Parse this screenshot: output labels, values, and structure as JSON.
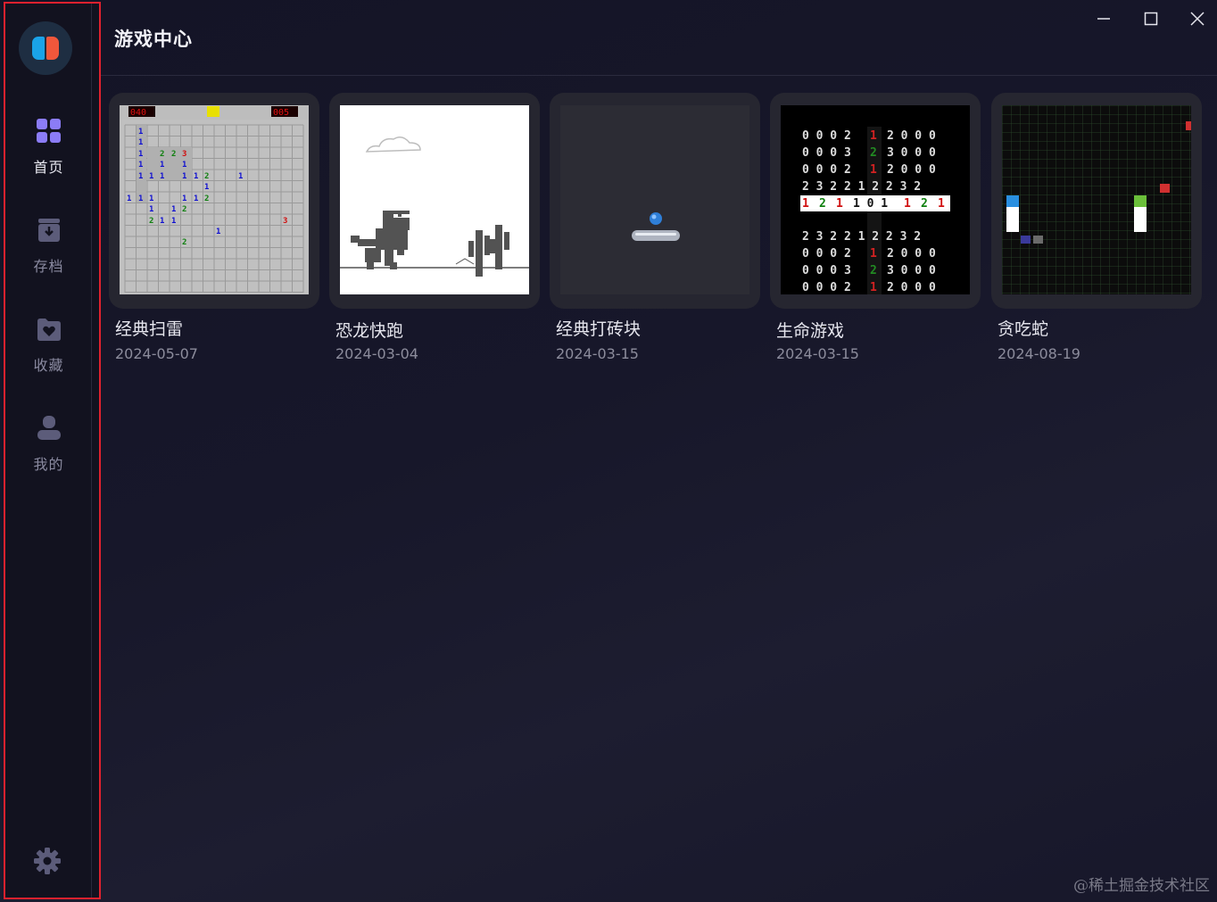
{
  "app": {
    "title": "游戏中心",
    "accent_color": "#8b7cf6",
    "highlight_border_color": "#e0212e"
  },
  "sidebar": {
    "logo_icon": "game-controller-logo",
    "items": [
      {
        "label": "首页",
        "icon": "grid-icon",
        "active": true
      },
      {
        "label": "存档",
        "icon": "archive-box-icon",
        "active": false
      },
      {
        "label": "收藏",
        "icon": "folder-heart-icon",
        "active": false
      },
      {
        "label": "我的",
        "icon": "user-icon",
        "active": false
      }
    ],
    "settings_icon": "gear-icon"
  },
  "window_controls": [
    "minimize-icon",
    "maximize-icon",
    "close-icon"
  ],
  "games": [
    {
      "title": "经典扫雷",
      "date": "2024-05-07",
      "thumbnail": "minesweeper"
    },
    {
      "title": "恐龙快跑",
      "date": "2024-03-04",
      "thumbnail": "dino-runner"
    },
    {
      "title": "经典打砖块",
      "date": "2024-03-15",
      "thumbnail": "breakout"
    },
    {
      "title": "生命游戏",
      "date": "2024-03-15",
      "thumbnail": "game-of-life"
    },
    {
      "title": "贪吃蛇",
      "date": "2024-08-19",
      "thumbnail": "snake"
    }
  ],
  "watermark": "@稀土掘金技术社区"
}
